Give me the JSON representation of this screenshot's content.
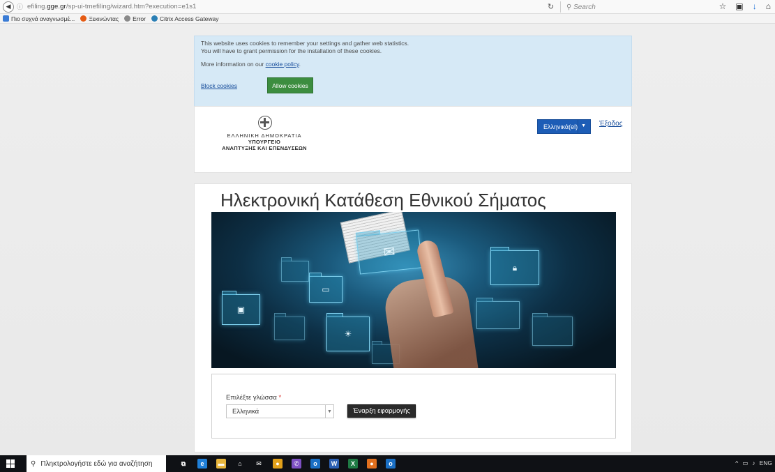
{
  "browser": {
    "url_prefix": "efiling.",
    "url_domain": "gge.gr",
    "url_path": "/sp-ui-tmefiling/wizard.htm?execution=e1s1",
    "search_placeholder": "Search",
    "bookmarks": [
      {
        "label": "Πιο συχνά αναγνωσμέ...",
        "color": "#3a7bd5"
      },
      {
        "label": "Ξεκινώντας",
        "color": "#e55b13"
      },
      {
        "label": "Error",
        "color": "#8a8a8a"
      },
      {
        "label": "Citrix Access Gateway",
        "color": "#2a7fb5"
      }
    ]
  },
  "cookie_banner": {
    "line1": "This website uses cookies to remember your settings and gather web statistics.",
    "line2": "You will have to grant permission for the installation of these cookies.",
    "more_prefix": "More information on our ",
    "policy_link": "cookie policy",
    "more_suffix": ".",
    "block_label": "Block cookies",
    "allow_label": "Allow cookies"
  },
  "header": {
    "gov_line1": "ΕΛΛΗΝΙΚΗ ΔΗΜΟΚΡΑΤΙΑ",
    "gov_line2": "ΥΠΟΥΡΓΕΙΟ",
    "gov_line3": "ΑΝΑΠΤΥΞΗΣ ΚΑΙ ΕΠΕΝΔΥΣΕΩΝ",
    "language_button": "Ελληνικά(el)",
    "exit_link": "Έξοδος"
  },
  "main": {
    "title": "Ηλεκτρονική Κατάθεση Εθνικού Σήματος",
    "language_label": "Επιλέξτε γλώσσα",
    "required_mark": "*",
    "language_value": "Ελληνικά",
    "start_button": "Έναρξη εφαρμογής"
  },
  "taskbar": {
    "search_placeholder": "Πληκτρολογήστε εδώ για αναζήτηση",
    "tray_text": "ENG",
    "apps": [
      {
        "name": "task-view-icon",
        "glyph": "⧉",
        "color": "#0f1115"
      },
      {
        "name": "edge-icon",
        "glyph": "e",
        "color": "#1f7fd8"
      },
      {
        "name": "file-explorer-icon",
        "glyph": "▬",
        "color": "#e8b53b"
      },
      {
        "name": "store-icon",
        "glyph": "⌂",
        "color": "#0f1115"
      },
      {
        "name": "mail-icon",
        "glyph": "✉",
        "color": "#0f1115"
      },
      {
        "name": "chrome-icon",
        "glyph": "●",
        "color": "#e2a11a"
      },
      {
        "name": "viber-icon",
        "glyph": "✆",
        "color": "#7d4fc2"
      },
      {
        "name": "outlook-icon",
        "glyph": "o",
        "color": "#1a6fc4"
      },
      {
        "name": "word-icon",
        "glyph": "W",
        "color": "#2b5fb3"
      },
      {
        "name": "excel-icon",
        "glyph": "X",
        "color": "#1f7a44"
      },
      {
        "name": "firefox-icon",
        "glyph": "●",
        "color": "#e2701e"
      },
      {
        "name": "outlook-2-icon",
        "glyph": "o",
        "color": "#1a6fc4"
      }
    ]
  }
}
